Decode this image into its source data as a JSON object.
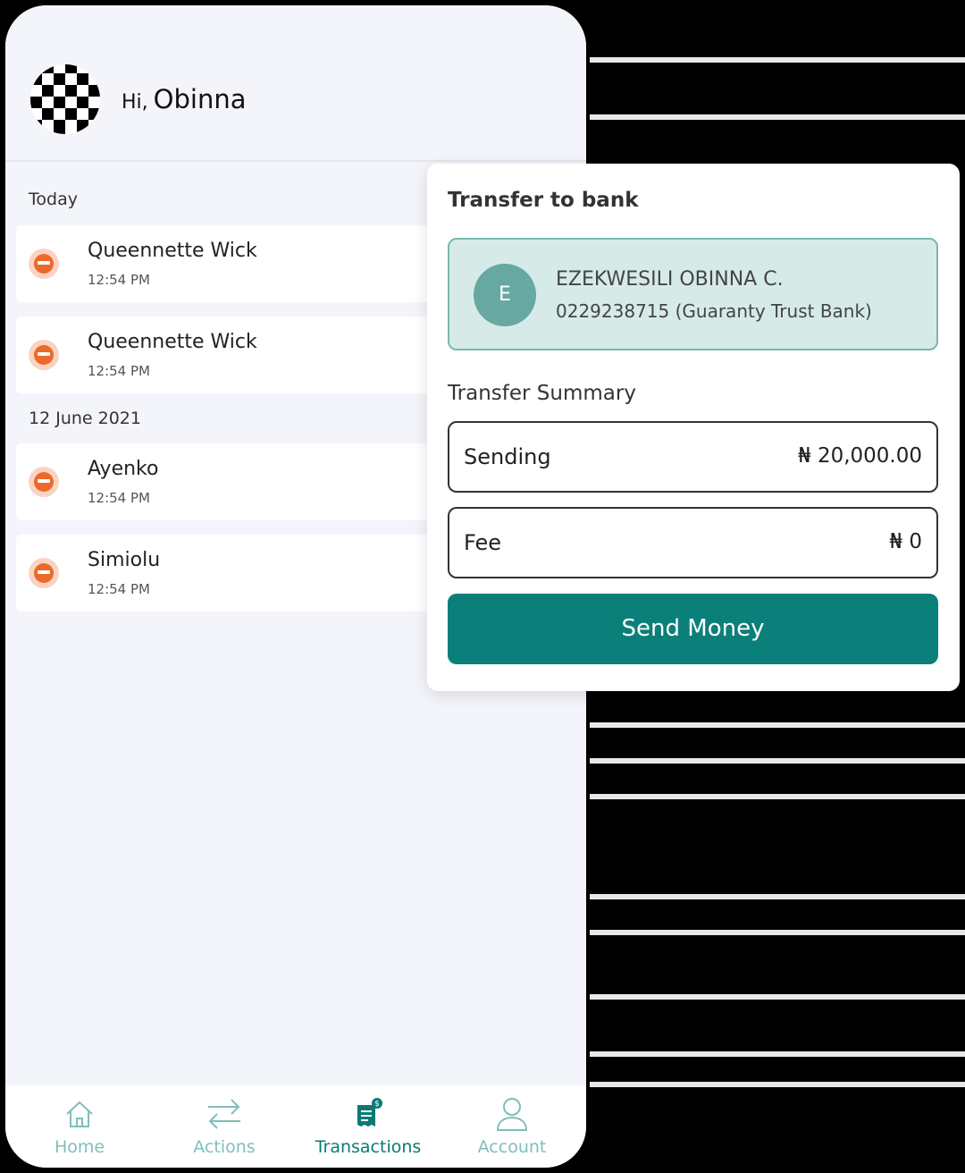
{
  "header": {
    "greeting": "Hi,",
    "user_name": "Obinna"
  },
  "sections": [
    {
      "label": "Today",
      "items": [
        {
          "name": "Queennette Wick",
          "time": "12:54 PM"
        },
        {
          "name": "Queennette Wick",
          "time": "12:54 PM"
        }
      ]
    },
    {
      "label": "12 June 2021",
      "items": [
        {
          "name": "Ayenko",
          "time": "12:54 PM"
        },
        {
          "name": "Simiolu",
          "time": "12:54 PM"
        }
      ]
    }
  ],
  "nav": {
    "items": [
      {
        "label": "Home",
        "icon": "home-icon"
      },
      {
        "label": "Actions",
        "icon": "transfer-arrows-icon"
      },
      {
        "label": "Transactions",
        "icon": "receipt-icon"
      },
      {
        "label": "Account",
        "icon": "user-icon"
      }
    ],
    "active": "Transactions"
  },
  "transfer": {
    "title": "Transfer to bank",
    "recipient": {
      "initial": "E",
      "name": "EZEKWESILI OBINNA C.",
      "account": "0229238715 (Guaranty Trust Bank)"
    },
    "summary_label": "Transfer Summary",
    "sending": {
      "label": "Sending",
      "value": "₦ 20,000.00"
    },
    "fee": {
      "label": "Fee",
      "value": "₦ 0"
    },
    "send_button": "Send Money"
  },
  "colors": {
    "accent": "#0b7f79",
    "recipient_bg": "#d6ebe8",
    "nav_inactive": "#7fbfb9",
    "bank_icon": "#ea6a2a"
  }
}
